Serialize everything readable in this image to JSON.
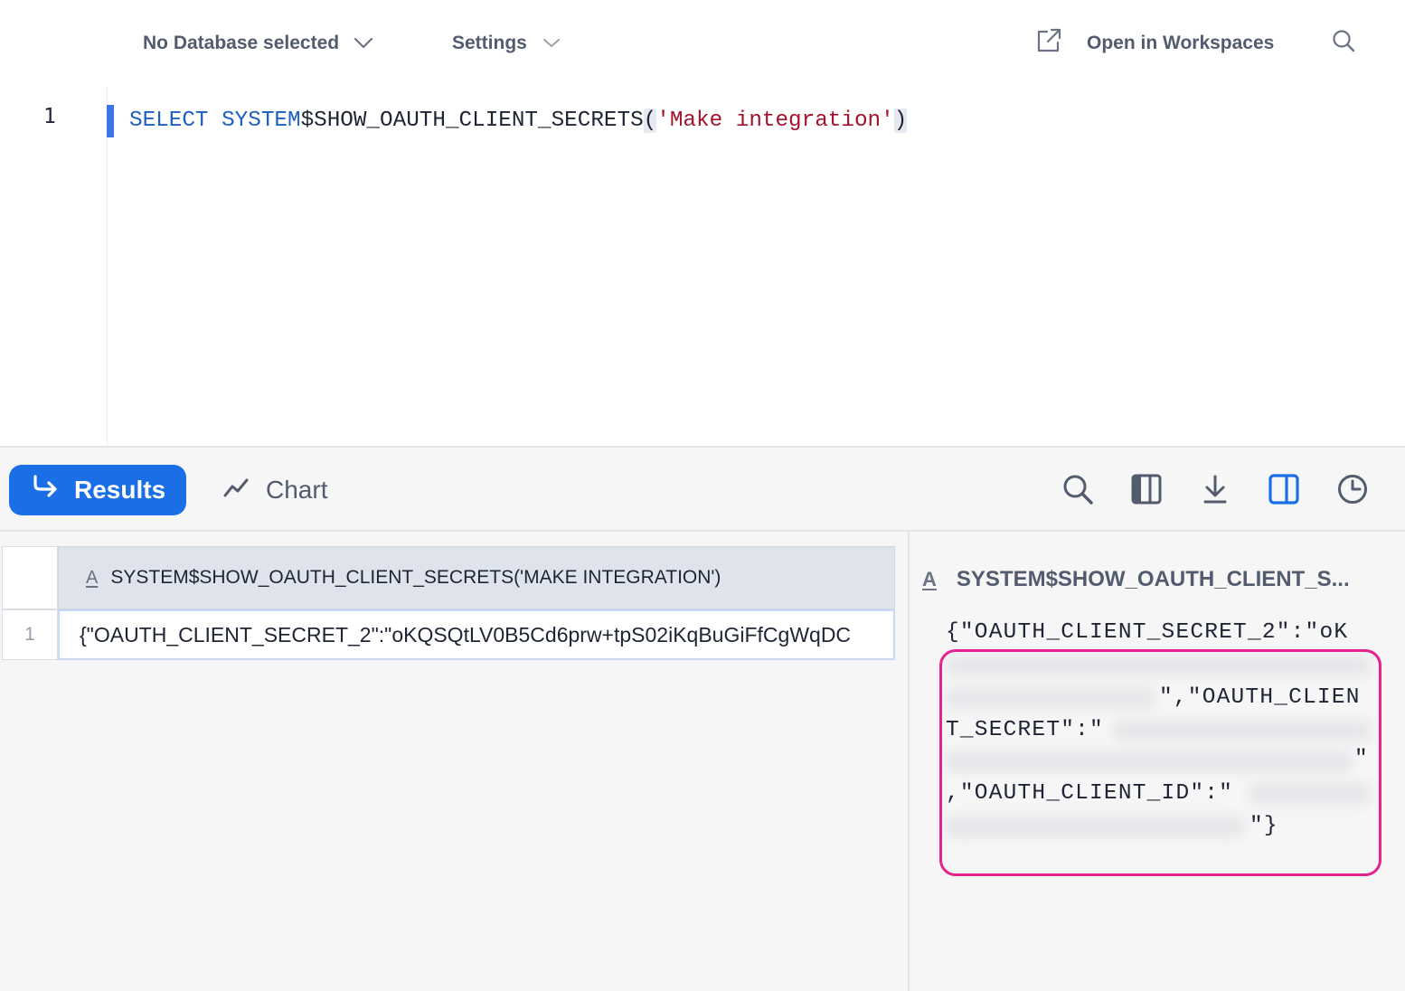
{
  "toolbar": {
    "database_label": "No Database selected",
    "settings_label": "Settings",
    "open_workspaces_label": "Open in Workspaces"
  },
  "editor": {
    "line_number": "1",
    "keyword": "SELECT",
    "fn_prefix": "SYSTEM",
    "fn_rest": "$SHOW_OAUTH_CLIENT_SECRETS",
    "open_paren": "(",
    "string_arg": "'Make integration'",
    "close_paren": ")"
  },
  "results": {
    "results_tab_label": "Results",
    "chart_tab_label": "Chart",
    "active_color": "#1a6fe6",
    "tools": [
      "search-icon",
      "columns-icon",
      "download-icon",
      "split-panel-icon",
      "history-icon"
    ]
  },
  "table": {
    "type_glyph": "A",
    "column_header": "SYSTEM$SHOW_OAUTH_CLIENT_SECRETS('MAKE INTEGRATION')",
    "rows": [
      {
        "num": "1",
        "value": "{\"OAUTH_CLIENT_SECRET_2\":\"oKQSQtLV0B5Cd6prw+tpS02iKqBuGiFfCgWqDC"
      }
    ]
  },
  "detail_panel": {
    "type_glyph": "A",
    "title": "SYSTEM$SHOW_OAUTH_CLIENT_S...",
    "lines": [
      "{\"OAUTH_CLIENT_SECRET_2\":\"oK",
      "\",\"OAUTH_CLIEN",
      "T_SECRET\":\"",
      "\"",
      ",\"OAUTH_CLIENT_ID\":\"",
      "\"}"
    ],
    "highlight_color": "#e6228f"
  }
}
